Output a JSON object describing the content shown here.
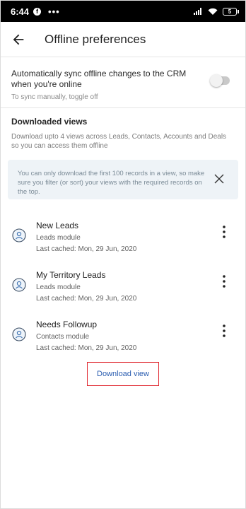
{
  "status_bar": {
    "time": "6:44",
    "fb_glyph": "f",
    "dots": "•••",
    "battery": "5"
  },
  "appbar": {
    "title": "Offline preferences"
  },
  "sync": {
    "label": "Automatically sync offline changes to the CRM when you're online",
    "hint": "To sync manually, toggle off",
    "toggle_on": false
  },
  "downloaded": {
    "heading": "Downloaded views",
    "description": "Download upto 4 views across Leads, Contacts, Accounts and Deals so you can access them offline",
    "banner": "You can only download the first 100 records in a view, so make sure you filter (or sort) your views with the required records on the top."
  },
  "views": [
    {
      "name": "New Leads",
      "module": "Leads module",
      "cached": "Last cached: Mon, 29 Jun, 2020"
    },
    {
      "name": "My Territory Leads",
      "module": "Leads module",
      "cached": "Last cached: Mon, 29 Jun, 2020"
    },
    {
      "name": "Needs Followup",
      "module": "Contacts module",
      "cached": "Last cached: Mon, 29 Jun, 2020"
    }
  ],
  "actions": {
    "download_label": "Download view"
  },
  "colors": {
    "accent_border": "#e0262e",
    "link": "#2a5db0",
    "banner_bg": "#eef3f7"
  }
}
